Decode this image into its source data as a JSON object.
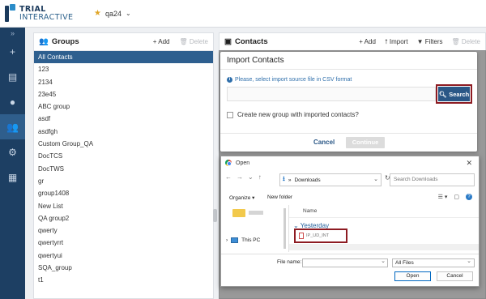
{
  "app": {
    "logo_line1": "TRIAL",
    "logo_line2": "INTERACTIVE",
    "study_name": "qa24"
  },
  "colors": {
    "nav_bg": "#1d3f63",
    "accent": "#2e5f8f",
    "highlight_border": "#8d1b22"
  },
  "sidenav": {
    "items": [
      {
        "name": "collapse",
        "icon": "chevron-double-right-icon",
        "glyph": "»"
      },
      {
        "name": "add",
        "icon": "plus-icon",
        "glyph": "+"
      },
      {
        "name": "documents",
        "icon": "document-icon",
        "glyph": "▤"
      },
      {
        "name": "status",
        "icon": "circle-icon",
        "glyph": "●"
      },
      {
        "name": "contacts",
        "icon": "users-icon",
        "glyph": "👥"
      },
      {
        "name": "settings",
        "icon": "gears-icon",
        "glyph": "⚙"
      },
      {
        "name": "table",
        "icon": "table-icon",
        "glyph": "▦"
      }
    ]
  },
  "groups_panel": {
    "title": "Groups",
    "add_label": "+ Add",
    "delete_label": "🗑 Delete",
    "items": [
      "All Contacts",
      "123",
      "2134",
      "23e45",
      "ABC group",
      "asdf",
      "asdfgh",
      "Custom Group_QA",
      "DocTCS",
      "DocTWS",
      "gr",
      "group1408",
      "New List",
      "QA group2",
      "qwerty",
      "qwertyrrt",
      "qwertyui",
      "SQA_group",
      "t1"
    ]
  },
  "contacts_panel": {
    "title": "Contacts",
    "add_label": "+ Add",
    "import_label": "⭡ Import",
    "filters_label": "▼ Filters",
    "delete_label": "🗑 Delete"
  },
  "import_modal": {
    "title": "Import Contacts",
    "info_text": "Please, select import source file in CSV format",
    "search_label": "Search",
    "checkbox_label": "Create new group with imported contacts?",
    "cancel_label": "Cancel",
    "continue_label": "Continue"
  },
  "open_dialog": {
    "title": "Open",
    "path_sep": "»",
    "path": "Downloads",
    "search_placeholder": "Search Downloads",
    "organize_label": "Organize ▾",
    "new_folder_label": "New folder",
    "this_pc_label": "This PC",
    "column_name": "Name",
    "group_label": "Yesterday",
    "file_name_visible": "IP_UD_INT",
    "file_name_label": "File name:",
    "filter_value": "All Files",
    "open_label": "Open",
    "cancel_label": "Cancel"
  }
}
